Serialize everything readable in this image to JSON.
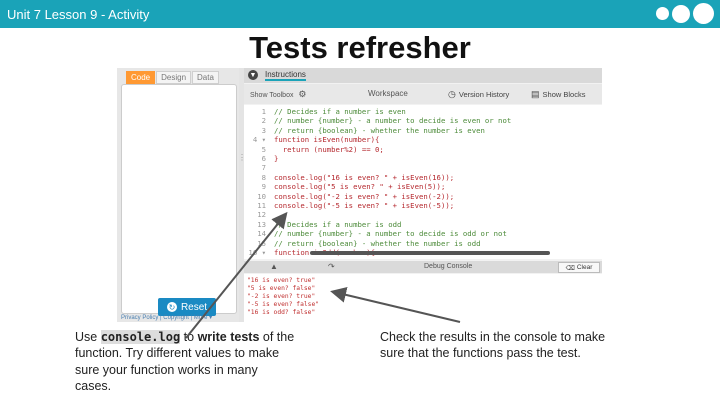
{
  "header": {
    "breadcrumb": "Unit 7 Lesson 9 - Activity"
  },
  "slide": {
    "title": "Tests refresher"
  },
  "app": {
    "mode_tabs": [
      "Code",
      "Design",
      "Data"
    ],
    "reset_label": "Reset",
    "footer_text": "Privacy Policy | Copyright | More ▾",
    "instructions_label": "Instructions",
    "show_toolbox": "Show Toolbox",
    "workspace_label": "Workspace",
    "version_history": "Version History",
    "show_blocks": "Show Blocks",
    "debug_console_label": "Debug Console",
    "clear_label": "Clear",
    "code_lines": [
      {
        "n": "1",
        "text": "// Decides if a number is even",
        "comment": true
      },
      {
        "n": "2",
        "text": "// number {number} - a number to decide is even or not",
        "comment": true
      },
      {
        "n": "3",
        "text": "// return {boolean} - whether the number is even",
        "comment": true
      },
      {
        "n": "4 ▾",
        "text": "function isEven(number){",
        "comment": false
      },
      {
        "n": "5",
        "text": "  return (number%2) == 0;",
        "comment": false
      },
      {
        "n": "6",
        "text": "}",
        "comment": false
      },
      {
        "n": "7",
        "text": "",
        "comment": false
      },
      {
        "n": "8",
        "text": "console.log(\"16 is even? \" + isEven(16));",
        "comment": false
      },
      {
        "n": "9",
        "text": "console.log(\"5 is even? \" + isEven(5));",
        "comment": false
      },
      {
        "n": "10",
        "text": "console.log(\"-2 is even? \" + isEven(-2));",
        "comment": false
      },
      {
        "n": "11",
        "text": "console.log(\"-5 is even? \" + isEven(-5));",
        "comment": false
      },
      {
        "n": "12",
        "text": "",
        "comment": false
      },
      {
        "n": "13",
        "text": "// Decides if a number is odd",
        "comment": true
      },
      {
        "n": "14",
        "text": "// number {number} - a number to decide is odd or not",
        "comment": true
      },
      {
        "n": "15",
        "text": "// return {boolean} - whether the number is odd",
        "comment": true
      },
      {
        "n": "16 ▾",
        "text": "function isOdd(number){",
        "comment": false
      }
    ],
    "console_output": [
      "\"16 is even? true\"",
      "\"5 is even? false\"",
      "\"-2 is even? true\"",
      "\"-5 is even? false\"",
      "\"16 is odd? false\""
    ]
  },
  "captions": {
    "left_pre": "Use ",
    "left_code": "console.log",
    "left_mid": " to ",
    "left_bold": "write tests",
    "left_post": " of the function. Try different values to make sure your function works in many cases.",
    "right": "Check the results in the console to make sure that the functions pass the test."
  },
  "colors": {
    "header_bar": "#1aa3b8",
    "active_tab": "#ff9933",
    "reset_button": "#1a8ac3",
    "code_text": "#b5282e",
    "comment_text": "#4b8a38"
  },
  "icons": [
    "gear-icon",
    "history-icon",
    "blocks-icon",
    "eraser-icon",
    "reset-icon",
    "chevron-icon"
  ]
}
